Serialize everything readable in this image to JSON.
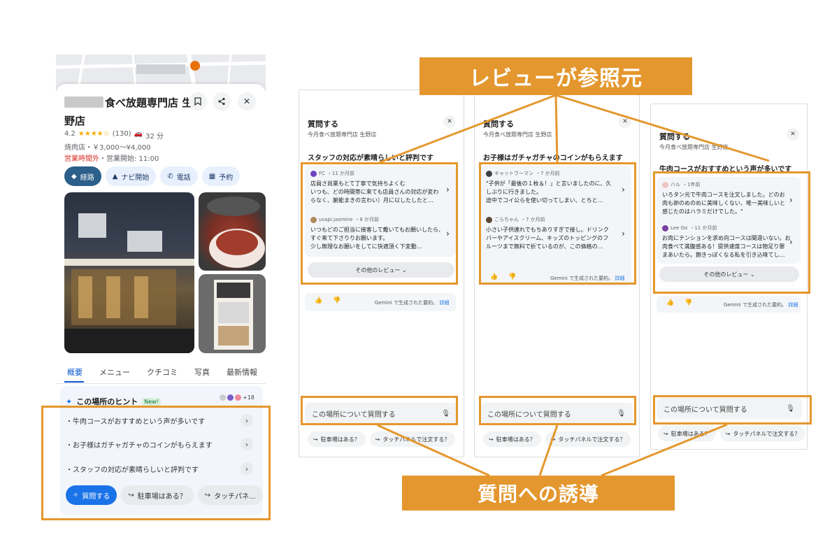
{
  "colors": {
    "accent": "#e4972e",
    "chip_blue": "#1a73e8",
    "closed_red": "#d93025"
  },
  "banners": {
    "top": "レビューが参照元",
    "bottom": "質問への誘導"
  },
  "place": {
    "title_line1": "食べ放題専門店 生",
    "title_line2": "野店",
    "rating": "4.2",
    "stars": "★★★★☆",
    "reviews": "(130)",
    "drive": "32 分",
    "category_price": "焼肉店・￥3,000〜¥4,000",
    "closed": "営業時間外",
    "open_text": "・営業開始: 11:00",
    "actions": [
      {
        "icon": "directions-icon",
        "label": "経路"
      },
      {
        "icon": "navigation-icon",
        "label": "ナビ開始"
      },
      {
        "icon": "phone-icon",
        "label": "電話"
      },
      {
        "icon": "calendar-icon",
        "label": "予約"
      }
    ],
    "tabs": [
      "概要",
      "メニュー",
      "クチコミ",
      "写真",
      "最新情報"
    ],
    "hints_title": "この場所のヒント",
    "hints_badge": "New!",
    "hints_count": "+18",
    "hints": [
      "・牛肉コースがおすすめという声が多いです",
      "・お子様はガチャガチャのコインがもらえます",
      "・スタッフの対応が素晴らしいと評判です"
    ],
    "ask_button": "質問する",
    "chips": [
      "駐車場はある？",
      "タッチパネ..."
    ]
  },
  "panels": [
    {
      "title": "質問する",
      "subtitle": "今月食べ放題専門店 生野店",
      "question": "スタッフの対応が素晴らしいと評判です",
      "reviews": [
        {
          "author": "FC",
          "time": "・11 か月前",
          "text": "店員さ尚業もとて丁寧で気持ちよくむ\nいつも、どの時間帯に来ても店員さんの対応が変わ\nらなく、腑能まきの言わい〕月に以したしたと…"
        },
        {
          "author": "usapi.jasmine",
          "time": "・8 か月前",
          "text": "いつもどのご担当に接客して戴いてもお願いしたら、\nすぐ来て下さりりお願います。\n少し無理なお願いをしてに快適頂く下変動…"
        }
      ],
      "more": "その他のレビュー ⌄",
      "gemini": "Gemini で生成された要約。",
      "detail": "詳細",
      "ask_placeholder": "この場所について質問する",
      "chips": [
        "駐車場はある？",
        "タッチパネルで注文する？"
      ]
    },
    {
      "title": "質問する",
      "subtitle": "今月食べ放題専門店 生野店",
      "question": "お子様はガチャガチャのコインがもらえます",
      "reviews": [
        {
          "author": "キャットウーマン",
          "time": "・7 か月前",
          "text": "\"子供が「最後の１枚＆！」と言いましたのに、久\nしぶりに行きました。\n途中でコイ公らを使い切ってしまい、とちと…"
        },
        {
          "author": "こらちゃん",
          "time": "・7 か月前",
          "text": "小さい子供連れでもちありすぎで接し。ドリンク\nバーやアイスクリーム、キッズのトッピングのフ\nルーツまで無料で折ているのが、この価格の…"
        }
      ],
      "more": "",
      "gemini": "Gemini で生成された要約。",
      "detail": "詳細",
      "ask_placeholder": "この場所について質問する",
      "chips": [
        "駐車場はある？",
        "タッチパネルで注文する？"
      ]
    },
    {
      "title": "質問する",
      "subtitle": "今月食べ放題専門店 生野店",
      "question": "牛肉コースがおすすめという声が多いです",
      "reviews": [
        {
          "author": "ハル",
          "time": "・1年前",
          "text": "いろタン元で牛肉コースを注文しました。どのお\n肉も卵のめのめに美味しくない、唯一美味しいと\n感じたのはハラミだけでした。\""
        },
        {
          "author": "Lee Go",
          "time": "・11 か月前",
          "text": "お肉にテンションを求め向コースは間違いない。お\n肉食べて満腹感ある！提供速度コースは物足り罪\nまあいたら。飽きっぽくなる私を引き込味てし…"
        }
      ],
      "more": "その他のレビュー ⌄",
      "gemini": "Gemini で生成された要約。",
      "detail": "詳細",
      "ask_placeholder": "この場所について質問する",
      "chips": [
        "駐車場はある？",
        "タッチパネルで注文する？"
      ]
    }
  ]
}
